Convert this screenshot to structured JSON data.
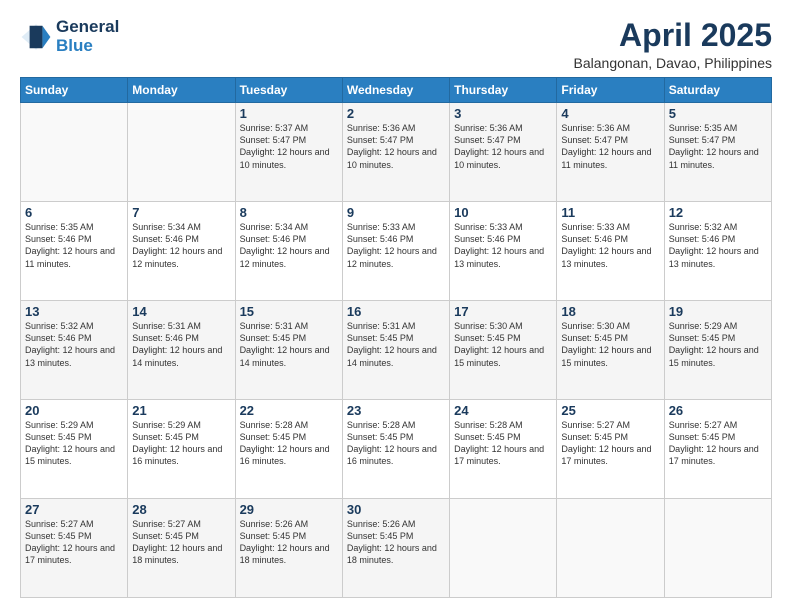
{
  "logo": {
    "line1": "General",
    "line2": "Blue"
  },
  "title": "April 2025",
  "subtitle": "Balangonan, Davao, Philippines",
  "weekdays": [
    "Sunday",
    "Monday",
    "Tuesday",
    "Wednesday",
    "Thursday",
    "Friday",
    "Saturday"
  ],
  "weeks": [
    [
      {
        "day": "",
        "sunrise": "",
        "sunset": "",
        "daylight": ""
      },
      {
        "day": "",
        "sunrise": "",
        "sunset": "",
        "daylight": ""
      },
      {
        "day": "1",
        "sunrise": "Sunrise: 5:37 AM",
        "sunset": "Sunset: 5:47 PM",
        "daylight": "Daylight: 12 hours and 10 minutes."
      },
      {
        "day": "2",
        "sunrise": "Sunrise: 5:36 AM",
        "sunset": "Sunset: 5:47 PM",
        "daylight": "Daylight: 12 hours and 10 minutes."
      },
      {
        "day": "3",
        "sunrise": "Sunrise: 5:36 AM",
        "sunset": "Sunset: 5:47 PM",
        "daylight": "Daylight: 12 hours and 10 minutes."
      },
      {
        "day": "4",
        "sunrise": "Sunrise: 5:36 AM",
        "sunset": "Sunset: 5:47 PM",
        "daylight": "Daylight: 12 hours and 11 minutes."
      },
      {
        "day": "5",
        "sunrise": "Sunrise: 5:35 AM",
        "sunset": "Sunset: 5:47 PM",
        "daylight": "Daylight: 12 hours and 11 minutes."
      }
    ],
    [
      {
        "day": "6",
        "sunrise": "Sunrise: 5:35 AM",
        "sunset": "Sunset: 5:46 PM",
        "daylight": "Daylight: 12 hours and 11 minutes."
      },
      {
        "day": "7",
        "sunrise": "Sunrise: 5:34 AM",
        "sunset": "Sunset: 5:46 PM",
        "daylight": "Daylight: 12 hours and 12 minutes."
      },
      {
        "day": "8",
        "sunrise": "Sunrise: 5:34 AM",
        "sunset": "Sunset: 5:46 PM",
        "daylight": "Daylight: 12 hours and 12 minutes."
      },
      {
        "day": "9",
        "sunrise": "Sunrise: 5:33 AM",
        "sunset": "Sunset: 5:46 PM",
        "daylight": "Daylight: 12 hours and 12 minutes."
      },
      {
        "day": "10",
        "sunrise": "Sunrise: 5:33 AM",
        "sunset": "Sunset: 5:46 PM",
        "daylight": "Daylight: 12 hours and 13 minutes."
      },
      {
        "day": "11",
        "sunrise": "Sunrise: 5:33 AM",
        "sunset": "Sunset: 5:46 PM",
        "daylight": "Daylight: 12 hours and 13 minutes."
      },
      {
        "day": "12",
        "sunrise": "Sunrise: 5:32 AM",
        "sunset": "Sunset: 5:46 PM",
        "daylight": "Daylight: 12 hours and 13 minutes."
      }
    ],
    [
      {
        "day": "13",
        "sunrise": "Sunrise: 5:32 AM",
        "sunset": "Sunset: 5:46 PM",
        "daylight": "Daylight: 12 hours and 13 minutes."
      },
      {
        "day": "14",
        "sunrise": "Sunrise: 5:31 AM",
        "sunset": "Sunset: 5:46 PM",
        "daylight": "Daylight: 12 hours and 14 minutes."
      },
      {
        "day": "15",
        "sunrise": "Sunrise: 5:31 AM",
        "sunset": "Sunset: 5:45 PM",
        "daylight": "Daylight: 12 hours and 14 minutes."
      },
      {
        "day": "16",
        "sunrise": "Sunrise: 5:31 AM",
        "sunset": "Sunset: 5:45 PM",
        "daylight": "Daylight: 12 hours and 14 minutes."
      },
      {
        "day": "17",
        "sunrise": "Sunrise: 5:30 AM",
        "sunset": "Sunset: 5:45 PM",
        "daylight": "Daylight: 12 hours and 15 minutes."
      },
      {
        "day": "18",
        "sunrise": "Sunrise: 5:30 AM",
        "sunset": "Sunset: 5:45 PM",
        "daylight": "Daylight: 12 hours and 15 minutes."
      },
      {
        "day": "19",
        "sunrise": "Sunrise: 5:29 AM",
        "sunset": "Sunset: 5:45 PM",
        "daylight": "Daylight: 12 hours and 15 minutes."
      }
    ],
    [
      {
        "day": "20",
        "sunrise": "Sunrise: 5:29 AM",
        "sunset": "Sunset: 5:45 PM",
        "daylight": "Daylight: 12 hours and 15 minutes."
      },
      {
        "day": "21",
        "sunrise": "Sunrise: 5:29 AM",
        "sunset": "Sunset: 5:45 PM",
        "daylight": "Daylight: 12 hours and 16 minutes."
      },
      {
        "day": "22",
        "sunrise": "Sunrise: 5:28 AM",
        "sunset": "Sunset: 5:45 PM",
        "daylight": "Daylight: 12 hours and 16 minutes."
      },
      {
        "day": "23",
        "sunrise": "Sunrise: 5:28 AM",
        "sunset": "Sunset: 5:45 PM",
        "daylight": "Daylight: 12 hours and 16 minutes."
      },
      {
        "day": "24",
        "sunrise": "Sunrise: 5:28 AM",
        "sunset": "Sunset: 5:45 PM",
        "daylight": "Daylight: 12 hours and 17 minutes."
      },
      {
        "day": "25",
        "sunrise": "Sunrise: 5:27 AM",
        "sunset": "Sunset: 5:45 PM",
        "daylight": "Daylight: 12 hours and 17 minutes."
      },
      {
        "day": "26",
        "sunrise": "Sunrise: 5:27 AM",
        "sunset": "Sunset: 5:45 PM",
        "daylight": "Daylight: 12 hours and 17 minutes."
      }
    ],
    [
      {
        "day": "27",
        "sunrise": "Sunrise: 5:27 AM",
        "sunset": "Sunset: 5:45 PM",
        "daylight": "Daylight: 12 hours and 17 minutes."
      },
      {
        "day": "28",
        "sunrise": "Sunrise: 5:27 AM",
        "sunset": "Sunset: 5:45 PM",
        "daylight": "Daylight: 12 hours and 18 minutes."
      },
      {
        "day": "29",
        "sunrise": "Sunrise: 5:26 AM",
        "sunset": "Sunset: 5:45 PM",
        "daylight": "Daylight: 12 hours and 18 minutes."
      },
      {
        "day": "30",
        "sunrise": "Sunrise: 5:26 AM",
        "sunset": "Sunset: 5:45 PM",
        "daylight": "Daylight: 12 hours and 18 minutes."
      },
      {
        "day": "",
        "sunrise": "",
        "sunset": "",
        "daylight": ""
      },
      {
        "day": "",
        "sunrise": "",
        "sunset": "",
        "daylight": ""
      },
      {
        "day": "",
        "sunrise": "",
        "sunset": "",
        "daylight": ""
      }
    ]
  ]
}
